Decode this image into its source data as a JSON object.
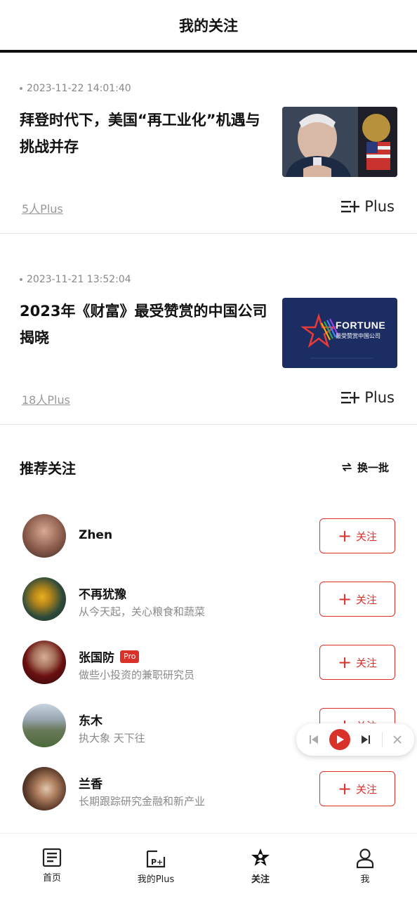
{
  "header": {
    "title": "我的关注"
  },
  "articles": [
    {
      "timestamp": "2023-11-22 14:01:40",
      "title": "拜登时代下，美国“再工业化”机遇与挑战并存",
      "plus_count": "5人Plus",
      "plus_label": "Plus"
    },
    {
      "timestamp": "2023-11-21 13:52:04",
      "title": "2023年《财富》最受赞赏的中国公司揭晓",
      "plus_count": "18人Plus",
      "plus_label": "Plus",
      "thumb_brand": "FORTUNE",
      "thumb_sub": "最受赞赏中国公司"
    }
  ],
  "recommend": {
    "title": "推荐关注",
    "refresh_label": "换一批",
    "follow_label": "关注",
    "users": [
      {
        "name": "Zhen",
        "desc": ""
      },
      {
        "name": "不再犹豫",
        "desc": "从今天起，关心粮食和蔬菜"
      },
      {
        "name": "张国防",
        "badge": "Pro",
        "desc": "做些小投资的兼职研究员"
      },
      {
        "name": "东木",
        "desc": "执大象 天下往"
      },
      {
        "name": "兰香",
        "desc": "长期跟踪研究金融和新产业"
      }
    ]
  },
  "tabbar": {
    "tabs": [
      {
        "label": "首页",
        "icon": "news-icon"
      },
      {
        "label": "我的Plus",
        "icon": "plus-doc-icon"
      },
      {
        "label": "关注",
        "icon": "star-person-icon",
        "active": true
      },
      {
        "label": "我",
        "icon": "person-icon"
      }
    ]
  },
  "colors": {
    "accent": "#d9322b",
    "text": "#111111",
    "muted": "#8a8a8a"
  }
}
